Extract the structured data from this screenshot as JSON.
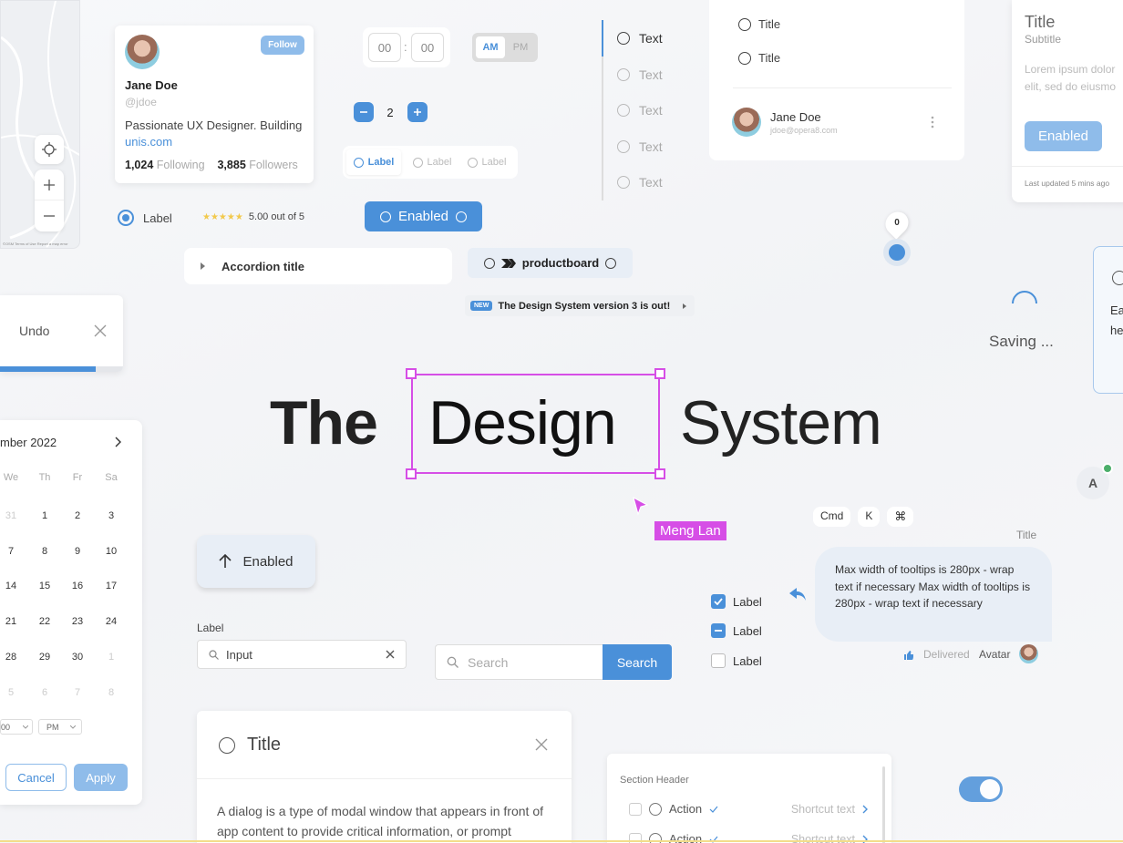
{
  "profile": {
    "name": "Jane Doe",
    "handle": "@jdoe",
    "follow_label": "Follow",
    "bio": "Passionate UX Designer. Building",
    "link": "unis.com",
    "following_count": "1,024",
    "following_label": "Following",
    "followers_count": "3,885",
    "followers_label": "Followers"
  },
  "map": {
    "legal": "©OSM  Terms of Use  Report a map error"
  },
  "time_picker": {
    "hour": "00",
    "minute": "00",
    "am": "AM",
    "pm": "PM"
  },
  "stepper": {
    "value": "2"
  },
  "radio_group": {
    "options": [
      "Label",
      "Label",
      "Label"
    ]
  },
  "radio_single": {
    "label": "Label"
  },
  "rating": {
    "stars": "★★★★★",
    "text": "5.00 out of 5"
  },
  "enabled_button": {
    "label": "Enabled"
  },
  "text_list": {
    "items": [
      "Text",
      "Text",
      "Text",
      "Text",
      "Text"
    ]
  },
  "title_radios": {
    "items": [
      "Title",
      "Title"
    ]
  },
  "user_row": {
    "name": "Jane Doe",
    "email": "jdoe@opera8.com"
  },
  "right_card": {
    "title": "Title",
    "subtitle": "Subtitle",
    "body_line1": "Lorem ipsum dolor",
    "body_line2": "elit, sed do eiusmo",
    "button": "Enabled",
    "footer": "Last updated 5 mins ago"
  },
  "accordion": {
    "title": "Accordion title"
  },
  "chip": {
    "label": "productboard"
  },
  "banner": {
    "badge": "NEW",
    "text": "The Design System version 3 is out!"
  },
  "slider": {
    "value": "0"
  },
  "saving": {
    "label": "Saving ..."
  },
  "right_edge": {
    "line1": "Ea",
    "line2": "he"
  },
  "undo_toast": {
    "label": "Undo",
    "progress": 0.78
  },
  "hero": {
    "word1": "The",
    "word2": "Design",
    "word3": "System"
  },
  "cursor": {
    "name": "Meng Lan"
  },
  "avatar_letter": "A",
  "calendar": {
    "month": "mber 2022",
    "weekdays": [
      "We",
      "Th",
      "Fr",
      "Sa"
    ],
    "rows": [
      [
        "31",
        "1",
        "2",
        "3"
      ],
      [
        "7",
        "8",
        "9",
        "10"
      ],
      [
        "14",
        "15",
        "16",
        "17"
      ],
      [
        "21",
        "22",
        "23",
        "24"
      ],
      [
        "28",
        "29",
        "30",
        "1"
      ],
      [
        "5",
        "6",
        "7",
        "8"
      ]
    ],
    "time_value": "00",
    "ampm": "PM",
    "cancel": "Cancel",
    "apply": "Apply"
  },
  "shortcut": {
    "cmd": "Cmd",
    "k": "K",
    "symbol": "⌘"
  },
  "tooltip": {
    "title": "Title",
    "text": "Max width of tooltips is 280px - wrap text if necessary Max width of tooltips is 280px - wrap text if necessary",
    "status": "Delivered",
    "avatar_label": "Avatar"
  },
  "upload_button": {
    "label": "Enabled"
  },
  "input": {
    "label": "Label",
    "value": "Input"
  },
  "search": {
    "placeholder": "Search",
    "button": "Search"
  },
  "checkboxes": {
    "items": [
      "Label",
      "Label",
      "Label"
    ]
  },
  "dialog": {
    "title": "Title",
    "body": "A dialog is a type of modal window that appears in front of app content to provide critical information, or prompt"
  },
  "menu": {
    "header": "Section Header",
    "items": [
      {
        "label": "Action",
        "shortcut": "Shortcut text"
      },
      {
        "label": "Action",
        "shortcut": "Shortcut text"
      }
    ]
  },
  "colors": {
    "accent": "#4a90d9",
    "magenta": "#d64ee6",
    "accent_light": "#8fbcea"
  }
}
